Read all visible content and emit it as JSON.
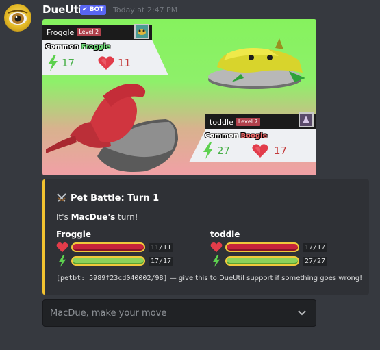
{
  "message": {
    "author": "DueUtil",
    "badge": "BOT",
    "timestamp": "Today at 2:47 PM"
  },
  "battle_image": {
    "player": {
      "name": "Froggle",
      "level": "Level 2",
      "rarity": "Common",
      "pet_name": "Froggle",
      "attack": "17",
      "health": "11"
    },
    "opponent": {
      "name": "toddle",
      "level": "Level 7",
      "rarity": "Common",
      "pet_name": "Boogle",
      "attack": "27",
      "health": "17"
    }
  },
  "embed": {
    "accent_color": "#f2c230",
    "title": "Pet Battle: Turn 1",
    "desc_prefix": "It's ",
    "desc_name": "MacDue's",
    "desc_suffix": " turn!",
    "fighters": [
      {
        "name": "Froggle",
        "hp": "11/11",
        "hp_fraction": 1.0,
        "energy": "17/17",
        "energy_fraction": 1.0
      },
      {
        "name": "toddle",
        "hp": "17/17",
        "hp_fraction": 1.0,
        "energy": "27/27",
        "energy_fraction": 1.0
      }
    ],
    "footer_code": "[petbt: 5989f23cd040002/98]",
    "footer_text": " — give this to DueUtil support if something goes wrong!"
  },
  "select": {
    "placeholder": "MacDue, make your move"
  },
  "icons": {
    "heart": "heart-icon",
    "lightning": "lightning-icon",
    "swords": "crossed-swords-icon",
    "chevron": "chevron-down-icon",
    "check": "checkmark-icon"
  }
}
